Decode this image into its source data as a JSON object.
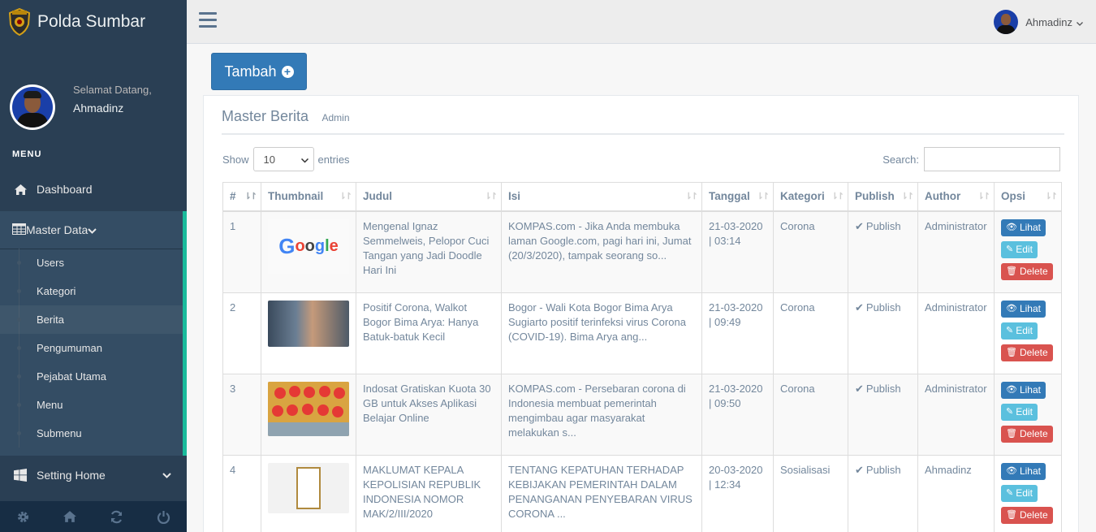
{
  "brand": {
    "title": "Polda Sumbar"
  },
  "profile": {
    "welcome": "Selamat Datang,",
    "name": "Ahmadinz"
  },
  "menu_heading": "MENU",
  "nav": {
    "dashboard": "Dashboard",
    "master_data": "Master Data",
    "sub_items": [
      "Users",
      "Kategori",
      "Berita",
      "Pengumuman",
      "Pejabat Utama",
      "Menu",
      "Submenu"
    ],
    "setting_home": "Setting Home"
  },
  "topbar": {
    "user_name": "Ahmadinz"
  },
  "actions": {
    "tambah": "Tambah"
  },
  "panel": {
    "title": "Master Berita",
    "subtitle": "Admin"
  },
  "datatable": {
    "show_label": "Show",
    "entries_value": "10",
    "entries_label": "entries",
    "search_label": "Search:"
  },
  "table": {
    "columns": [
      "#",
      "Thumbnail",
      "Judul",
      "Isi",
      "Tanggal",
      "Kategori",
      "Publish",
      "Author",
      "Opsi"
    ],
    "buttons": {
      "lihat": "Lihat",
      "edit": "Edit",
      "delete": "Delete"
    },
    "rows": [
      {
        "no": "1",
        "judul": "Mengenal Ignaz Semmelweis, Pelopor Cuci Tangan yang Jadi Doodle Hari Ini",
        "isi": "KOMPAS.com - Jika Anda membuka laman Google.com, pagi hari ini, Jumat (20/3/2020), tampak seorang so...",
        "tanggal_date": "21-03-2020",
        "tanggal_time": "| 03:14",
        "kategori": "Corona",
        "publish": "Publish",
        "author": "Administrator"
      },
      {
        "no": "2",
        "judul": "Positif Corona, Walkot Bogor Bima Arya: Hanya Batuk-batuk Kecil",
        "isi": "Bogor - Wali Kota Bogor Bima Arya Sugiarto positif terinfeksi virus Corona (COVID-19). Bima Arya ang...",
        "tanggal_date": "21-03-2020",
        "tanggal_time": "| 09:49",
        "kategori": "Corona",
        "publish": "Publish",
        "author": "Administrator"
      },
      {
        "no": "3",
        "judul": "Indosat Gratiskan Kuota 30 GB untuk Akses Aplikasi Belajar Online",
        "isi": "KOMPAS.com - Persebaran corona di Indonesia membuat pemerintah mengimbau agar masyarakat melakukan s...",
        "tanggal_date": "21-03-2020",
        "tanggal_time": "| 09:50",
        "kategori": "Corona",
        "publish": "Publish",
        "author": "Administrator"
      },
      {
        "no": "4",
        "judul": "MAKLUMAT KEPALA KEPOLISIAN REPUBLIK INDONESIA NOMOR MAK/2/III/2020",
        "isi": "TENTANG KEPATUHAN TERHADAP KEBIJAKAN PEMERINTAH DALAM PENANGANAN PENYEBARAN VIRUS CORONA ...",
        "tanggal_date": "20-03-2020",
        "tanggal_time": "| 12:34",
        "kategori": "Sosialisasi",
        "publish": "Publish",
        "author": "Ahmadinz"
      }
    ]
  },
  "icons": {
    "home": "home-icon",
    "table": "table-icon",
    "windows": "windows-icon",
    "gear": "gear-icon",
    "refresh": "refresh-icon",
    "power": "power-icon"
  },
  "colors": {
    "sidebar": "#2a3f54",
    "accent": "#1abb9c",
    "primary": "#337ab7",
    "info": "#5bc0de",
    "danger": "#d9534f"
  }
}
